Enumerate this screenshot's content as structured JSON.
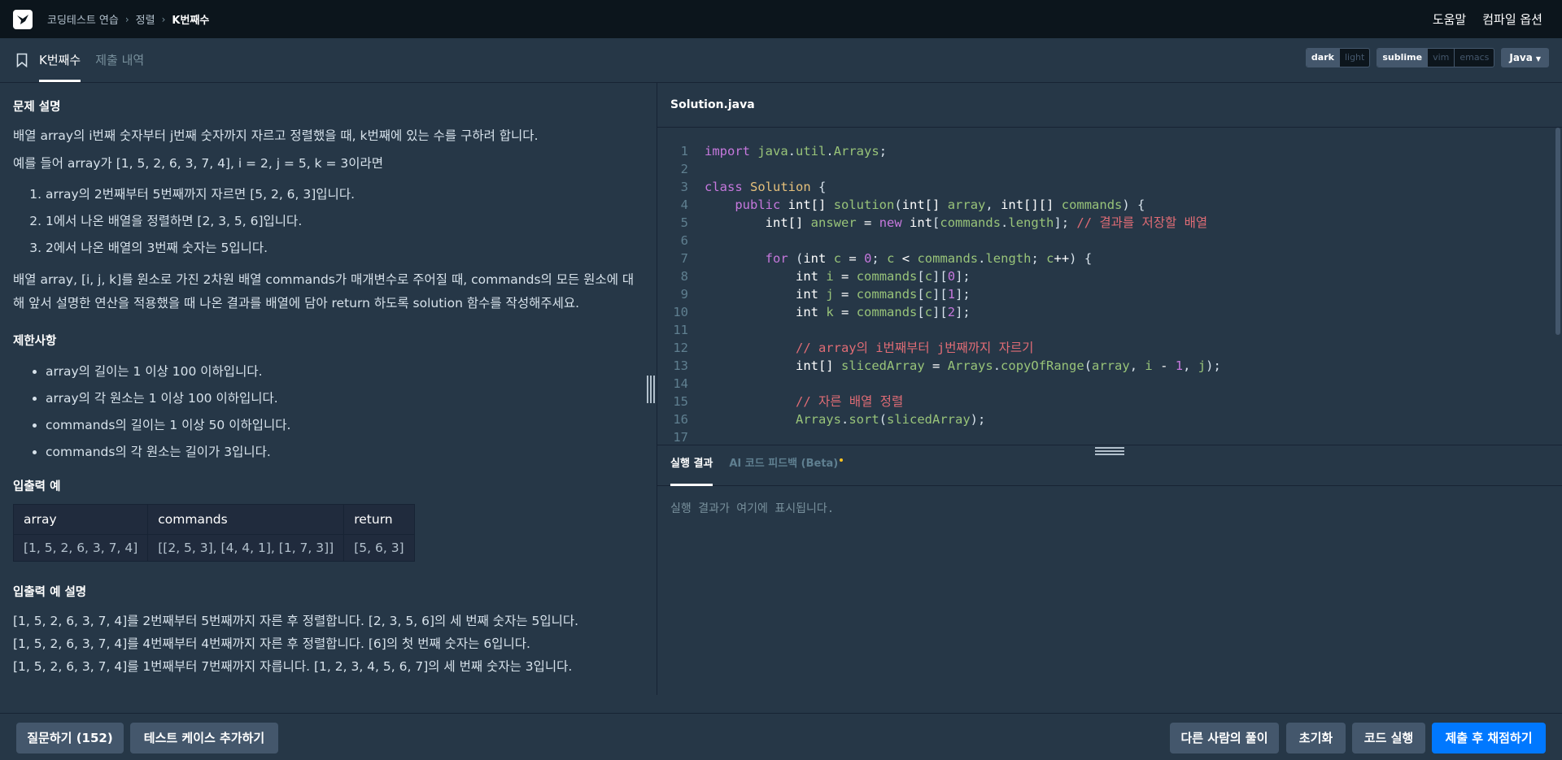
{
  "nav": {
    "breadcrumb": [
      "코딩테스트 연습",
      "정렬",
      "K번째수"
    ],
    "right": [
      "도움말",
      "컴파일 옵션"
    ]
  },
  "tabs": {
    "active": "K번째수",
    "inactive": "제출 내역"
  },
  "controls": {
    "theme": [
      "dark",
      "light"
    ],
    "keymap": [
      "sublime",
      "vim",
      "emacs"
    ],
    "language": "Java"
  },
  "problem": {
    "h_desc": "문제 설명",
    "p1": "배열 array의 i번째 숫자부터 j번째 숫자까지 자르고 정렬했을 때, k번째에 있는 수를 구하려 합니다.",
    "p2": "예를 들어 array가 [1, 5, 2, 6, 3, 7, 4], i = 2, j = 5, k = 3이라면",
    "steps": [
      "array의 2번째부터 5번째까지 자르면 [5, 2, 6, 3]입니다.",
      "1에서 나온 배열을 정렬하면 [2, 3, 5, 6]입니다.",
      "2에서 나온 배열의 3번째 숫자는 5입니다."
    ],
    "p3a": "배열 array, [i, j, k]를 원소로 가진 2차원 배열 commands가 매개변수로 주어질 때, commands의 모든 원소에 대",
    "p3b": "해 앞서 설명한 연산을 적용했을 때 나온 결과를 배열에 담아 return 하도록 solution 함수를 작성해주세요.",
    "h_limit": "제한사항",
    "limits": [
      "array의 길이는 1 이상 100 이하입니다.",
      "array의 각 원소는 1 이상 100 이하입니다.",
      "commands의 길이는 1 이상 50 이하입니다.",
      "commands의 각 원소는 길이가 3입니다."
    ],
    "h_io": "입출력 예",
    "table": {
      "headers": [
        "array",
        "commands",
        "return"
      ],
      "row": [
        "[1, 5, 2, 6, 3, 7, 4]",
        "[[2, 5, 3], [4, 4, 1], [1, 7, 3]]",
        "[5, 6, 3]"
      ]
    },
    "h_io_desc": "입출력 예 설명",
    "io_desc": [
      "[1, 5, 2, 6, 3, 7, 4]를 2번째부터 5번째까지 자른 후 정렬합니다. [2, 3, 5, 6]의 세 번째 숫자는 5입니다.",
      "[1, 5, 2, 6, 3, 7, 4]를 4번째부터 4번째까지 자른 후 정렬합니다. [6]의 첫 번째 숫자는 6입니다.",
      "[1, 5, 2, 6, 3, 7, 4]를 1번째부터 7번째까지 자릅니다. [1, 2, 3, 4, 5, 6, 7]의 세 번째 숫자는 3입니다."
    ]
  },
  "editor": {
    "filename": "Solution.java",
    "line_numbers": [
      "1",
      "2",
      "3",
      "4",
      "5",
      "6",
      "7",
      "8",
      "9",
      "10",
      "11",
      "12",
      "13",
      "14",
      "15",
      "16",
      "17"
    ]
  },
  "result": {
    "tab_on": "실행 결과",
    "tab_off": "AI 코드 피드백 (Beta)",
    "placeholder": "실행 결과가 여기에 표시됩니다."
  },
  "buttons": {
    "question": "질문하기 (152)",
    "add_test": "테스트 케이스 추가하기",
    "others": "다른 사람의 풀이",
    "reset": "초기화",
    "run": "코드 실행",
    "submit": "제출 후 채점하기"
  }
}
